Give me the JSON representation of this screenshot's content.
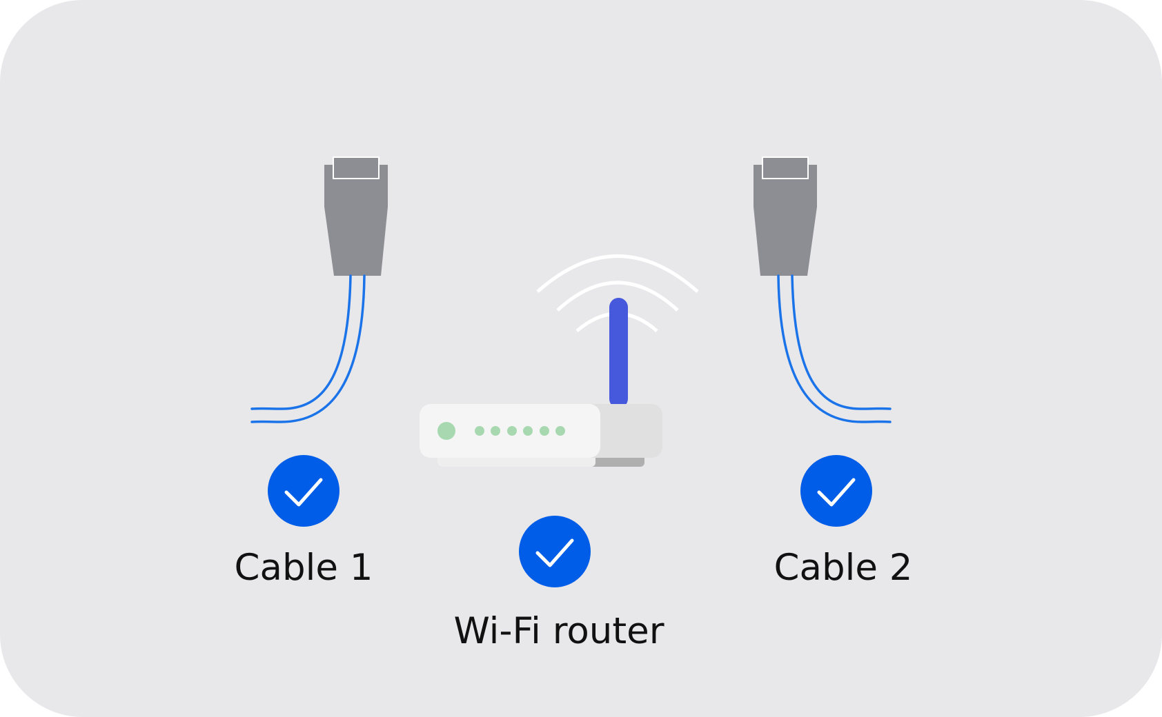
{
  "items": {
    "cable_1": {
      "label": "Cable 1",
      "status": "check-circle-icon"
    },
    "router": {
      "label": "Wi-Fi router",
      "status": "check-circle-icon"
    },
    "cable_2": {
      "label": "Cable 2",
      "status": "check-circle-icon"
    }
  },
  "colors": {
    "background": "#e8e8ea",
    "check_blue": "#005de8",
    "wire_blue": "#1a73e8",
    "connector_gray": "#8d8d94",
    "antenna_blue": "#4658db",
    "led_green": "#a8d8b0",
    "wifi_waves": "#ffffff"
  }
}
